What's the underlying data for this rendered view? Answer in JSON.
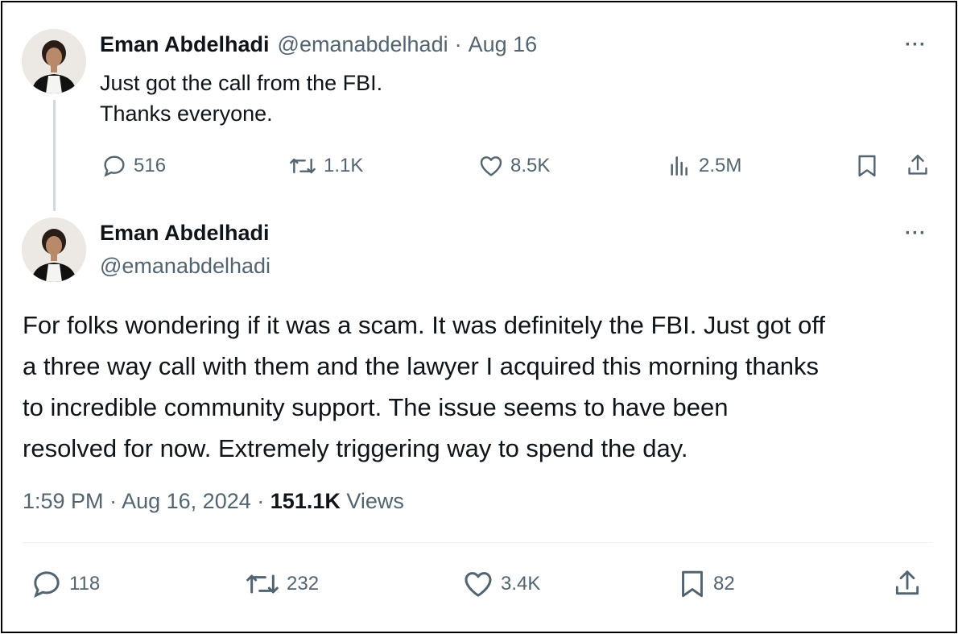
{
  "tweet1": {
    "name": "Eman Abdelhadi",
    "handle": "@emanabdelhadi",
    "separator": "·",
    "date": "Aug 16",
    "text_lines": [
      "Just got the call from the FBI.",
      "Thanks everyone."
    ],
    "more": "···",
    "actions": {
      "replies": "516",
      "reposts": "1.1K",
      "likes": "8.5K",
      "views": "2.5M"
    }
  },
  "tweet2": {
    "name": "Eman Abdelhadi",
    "handle": "@emanabdelhadi",
    "more": "···",
    "text_lines": [
      "For folks wondering if it was a scam. It was definitely the FBI. Just got off",
      "a three way call with them and the lawyer I acquired this morning thanks",
      "to incredible community support. The issue seems to have been",
      "resolved for now. Extremely triggering way to spend the day."
    ],
    "meta": {
      "time": "1:59 PM",
      "separator": "·",
      "date": "Aug 16, 2024",
      "views_count": "151.1K",
      "views_label": "Views"
    },
    "actions": {
      "replies": "118",
      "reposts": "232",
      "likes": "3.4K",
      "bookmarks": "82"
    }
  },
  "icons": {
    "reply": "reply-icon",
    "repost": "repost-icon",
    "like": "heart-icon",
    "views": "views-icon",
    "bookmark": "bookmark-icon",
    "share": "share-icon"
  },
  "colors": {
    "text": "#0f1419",
    "muted": "#536471",
    "thread_line": "#cfd9de",
    "divider": "#eff3f4"
  }
}
